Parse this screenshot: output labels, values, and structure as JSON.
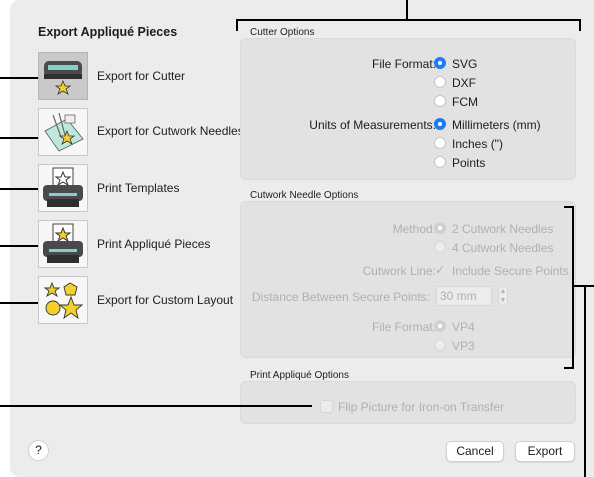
{
  "dialog": {
    "title": "Export Appliqué Pieces"
  },
  "items": [
    {
      "label": "Export for Cutter",
      "icon": "cutter-icon",
      "selected": true
    },
    {
      "label": "Export for Cutwork Needles",
      "icon": "cutwork-needles-icon",
      "selected": false
    },
    {
      "label": "Print Templates",
      "icon": "printer-template-icon",
      "selected": false
    },
    {
      "label": "Print Appliqué Pieces",
      "icon": "printer-applique-icon",
      "selected": false
    },
    {
      "label": "Export for Custom Layout",
      "icon": "custom-layout-icon",
      "selected": false
    }
  ],
  "cutter_options": {
    "title": "Cutter Options",
    "file_format_label": "File Format:",
    "file_formats": [
      "SVG",
      "DXF",
      "FCM"
    ],
    "file_format_selected": "SVG",
    "units_label": "Units of Measurements:",
    "units": [
      "Millimeters (mm)",
      "Inches (\")",
      "Points"
    ],
    "units_selected": "Millimeters (mm)"
  },
  "cutwork_options": {
    "title": "Cutwork Needle Options",
    "method_label": "Method:",
    "methods": [
      "2 Cutwork Needles",
      "4 Cutwork Needles"
    ],
    "method_selected": "2 Cutwork Needles",
    "cutwork_line_label": "Cutwork Line:",
    "include_secure_points": "Include Secure Points",
    "distance_label": "Distance Between Secure Points:",
    "distance_value": "30 mm",
    "file_format_label": "File Format:",
    "file_formats": [
      "VP4",
      "VP3"
    ],
    "file_format_selected": "VP4"
  },
  "print_options": {
    "title": "Print Appliqué Options",
    "flip_label": "Flip Picture for Iron-on Transfer"
  },
  "buttons": {
    "help": "?",
    "cancel": "Cancel",
    "export": "Export"
  },
  "colors": {
    "accent": "#1d7cf0",
    "star": "#f5cf2e"
  }
}
